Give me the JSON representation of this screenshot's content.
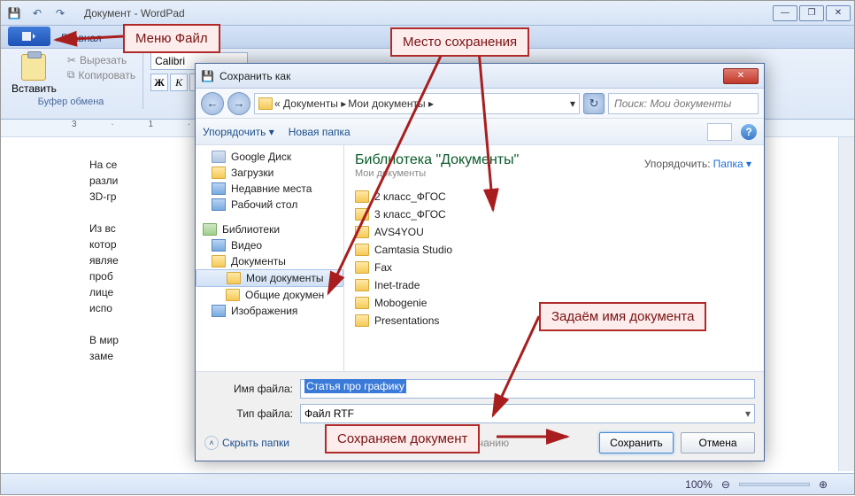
{
  "app": {
    "title": "Документ - WordPad"
  },
  "qat": {
    "save": "💾",
    "undo": "↶",
    "redo": "↷"
  },
  "ribbon": {
    "tab_home": "Главная",
    "paste": "Вставить",
    "cut": "Вырезать",
    "copy": "Копировать",
    "clipboard_group": "Буфер обмена",
    "font_name": "Calibri",
    "bold": "Ж",
    "italic": "К",
    "underline": "Ч"
  },
  "ruler_marks": "3 · 1 · 2 · 1 · 1 · 1",
  "doc": {
    "p1": "На се",
    "p2": "разли",
    "p3": "3D-гр",
    "p4": "Из вс",
    "p5": "котор",
    "p6": "являе",
    "p7": "проб",
    "p8": "лице",
    "p9": "испо",
    "p10": "В мир",
    "p11": "заме"
  },
  "status": {
    "zoom": "100%",
    "plus": "⊕",
    "minus": "⊖"
  },
  "dialog": {
    "title": "Сохранить как",
    "back": "←",
    "fwd": "→",
    "breadcrumb_pre": "«  Документы  ▸",
    "breadcrumb_cur": "Мои документы  ▸",
    "refresh": "↻",
    "search_placeholder": "Поиск: Мои документы",
    "organize": "Упорядочить ▾",
    "newfolder": "Новая папка",
    "help": "?",
    "lib_title": "Библиотека \"Документы\"",
    "lib_sub": "Мои документы",
    "sort_label": "Упорядочить:",
    "sort_value": "Папка ▾",
    "tree": {
      "gdrive": "Google Диск",
      "downloads": "Загрузки",
      "recent": "Недавние места",
      "desktop": "Рабочий стол",
      "libs": "Библиотеки",
      "video": "Видео",
      "docs": "Документы",
      "mydocs": "Мои документы",
      "pubdocs": "Общие докумен",
      "pics": "Изображения"
    },
    "folders": [
      "2 класс_ФГОС",
      "3 класс_ФГОС",
      "AVS4YOU",
      "Camtasia Studio",
      "Fax",
      "Inet-trade",
      "Mobogenie",
      "Presentations"
    ],
    "filename_label": "Имя файла:",
    "filename_value": "Статья про графику",
    "filetype_label": "Тип файла:",
    "filetype_value": "Файл RTF",
    "default_chk": "По умолчанию",
    "hide_folders": "Скрыть папки",
    "save_btn": "Сохранить",
    "cancel_btn": "Отмена"
  },
  "annotations": {
    "menu_file": "Меню Файл",
    "save_location": "Место сохранения",
    "set_name": "Задаём имя документа",
    "do_save": "Сохраняем документ"
  }
}
